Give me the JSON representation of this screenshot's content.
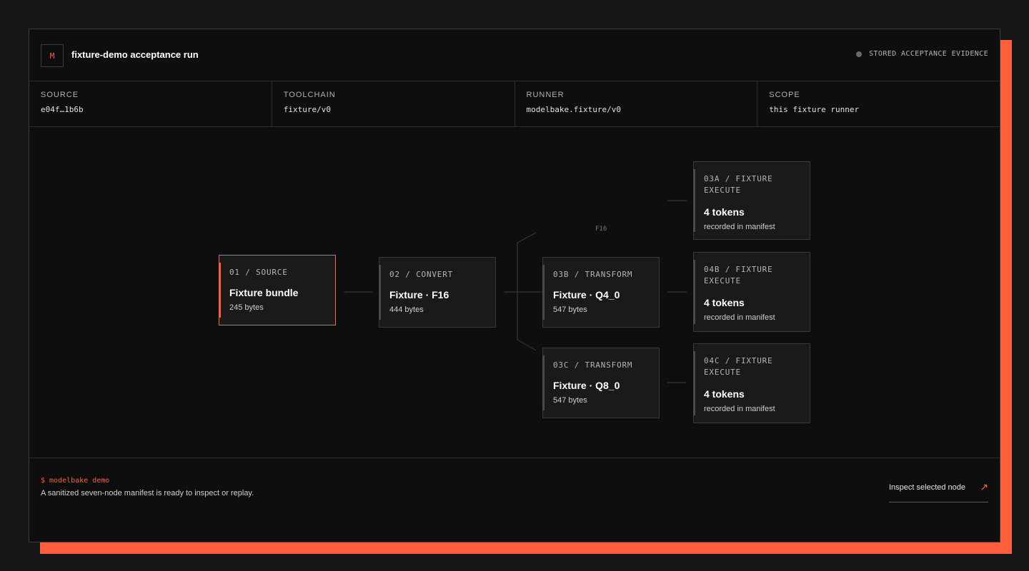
{
  "header": {
    "logo": "M",
    "title": "fixture-demo acceptance run",
    "status": "STORED ACCEPTANCE EVIDENCE"
  },
  "meta": [
    {
      "label": "SOURCE",
      "value": "e04f…1b6b"
    },
    {
      "label": "TOOLCHAIN",
      "value": "fixture/v0"
    },
    {
      "label": "RUNNER",
      "value": "modelbake.fixture/v0"
    },
    {
      "label": "SCOPE",
      "value": "this fixture runner"
    }
  ],
  "graph": {
    "edge_label": "F16",
    "nodes": {
      "n01": {
        "label": "01 / SOURCE",
        "title": "Fixture bundle",
        "sub": "245 bytes"
      },
      "n02": {
        "label": "02 / CONVERT",
        "title": "Fixture · F16",
        "sub": "444 bytes"
      },
      "n03b": {
        "label": "03B / TRANSFORM",
        "title": "Fixture · Q4_0",
        "sub": "547 bytes"
      },
      "n03c": {
        "label": "03C / TRANSFORM",
        "title": "Fixture · Q8_0",
        "sub": "547 bytes"
      },
      "n03a": {
        "label": "03A / FIXTURE EXECUTE",
        "title": "4 tokens",
        "sub": "recorded in manifest"
      },
      "n04b": {
        "label": "04B / FIXTURE EXECUTE",
        "title": "4 tokens",
        "sub": "recorded in manifest"
      },
      "n04c": {
        "label": "04C / FIXTURE EXECUTE",
        "title": "4 tokens",
        "sub": "recorded in manifest"
      }
    }
  },
  "footer": {
    "command": "$ modelbake demo",
    "message": "A sanitized seven-node manifest is ready to inspect or replay.",
    "inspect_label": "Inspect selected node",
    "inspect_icon": "arrow-up-right-icon"
  },
  "colors": {
    "accent": "#ff5f3a",
    "background": "#171717",
    "panel": "#0e0e0e",
    "node": "#1a1a1a"
  }
}
